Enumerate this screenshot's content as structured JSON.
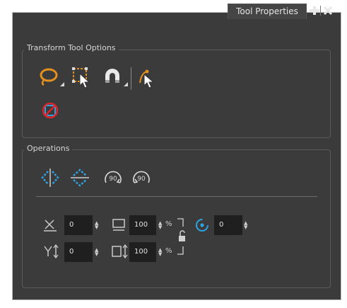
{
  "panel": {
    "tab_label": "Tool Properties",
    "add_icon": "plus-icon",
    "close_icon": "close-icon"
  },
  "transform_options": {
    "title": "Transform Tool Options",
    "tools": [
      {
        "name": "lasso-select-icon"
      },
      {
        "name": "marquee-select-icon"
      },
      {
        "name": "snap-magnet-icon"
      },
      {
        "name": "select-by-color-icon"
      },
      {
        "name": "no-apply-icon"
      }
    ]
  },
  "operations": {
    "title": "Operations",
    "buttons": [
      {
        "name": "flip-horizontal-icon"
      },
      {
        "name": "flip-vertical-icon"
      },
      {
        "name": "rotate-90-cw-icon",
        "text": "90"
      },
      {
        "name": "rotate-90-ccw-icon",
        "text": "90"
      }
    ],
    "fields": {
      "x": "0",
      "y": "0",
      "width": "100",
      "height": "100",
      "angle": "0",
      "percent": "%"
    }
  },
  "colors": {
    "panel_bg": "#3b3b3b",
    "accent_orange": "#e4901f",
    "accent_blue": "#2ea3e0",
    "accent_red": "#d9262c",
    "field_bg": "#1f1f1f"
  }
}
